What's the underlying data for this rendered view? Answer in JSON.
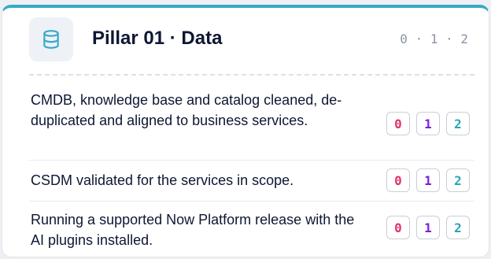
{
  "pillar": {
    "title": "Pillar 01 · Data",
    "scale_legend": "0 · 1 · 2",
    "icon": "database-icon",
    "accent_color": "#38a9c9"
  },
  "score_colors": {
    "0": "#e0346a",
    "1": "#7b22d6",
    "2": "#2aa5b5"
  },
  "criteria": [
    {
      "text": "CMDB, knowledge base and catalog cleaned, de-duplicated and aligned to business services.",
      "scores": [
        "0",
        "1",
        "2"
      ]
    },
    {
      "text": "CSDM validated for the services in scope.",
      "scores": [
        "0",
        "1",
        "2"
      ]
    },
    {
      "text": "Running a supported Now Platform release with the AI plugins installed.",
      "scores": [
        "0",
        "1",
        "2"
      ]
    }
  ]
}
